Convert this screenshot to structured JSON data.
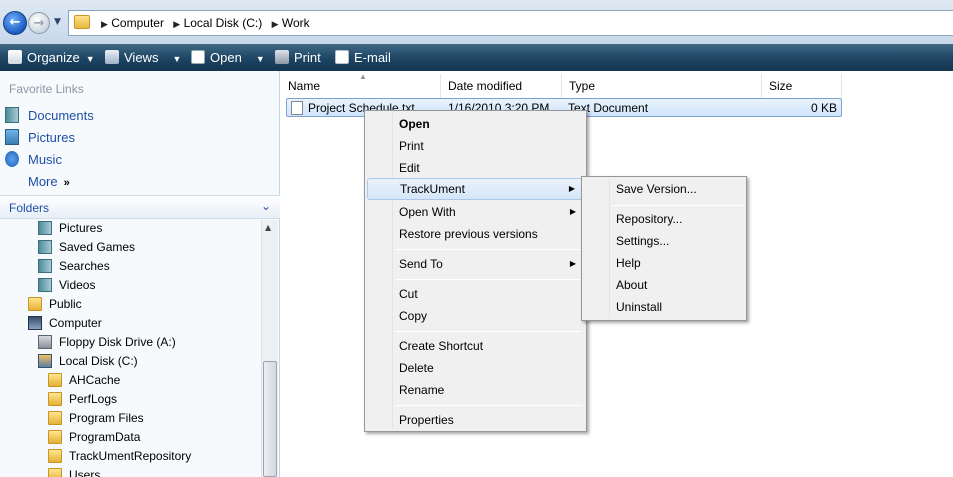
{
  "address": {
    "crumbs": [
      "Computer",
      "Local Disk (C:)",
      "Work"
    ]
  },
  "commandbar": {
    "organize": "Organize",
    "views": "Views",
    "open": "Open",
    "print": "Print",
    "email": "E-mail"
  },
  "leftpane": {
    "favorites_title": "Favorite Links",
    "favorites": [
      "Documents",
      "Pictures",
      "Music"
    ],
    "more": "More",
    "folders_title": "Folders",
    "tree": [
      "Pictures",
      "Saved Games",
      "Searches",
      "Videos",
      "Public",
      "Computer",
      "Floppy Disk Drive (A:)",
      "Local Disk (C:)",
      "AHCache",
      "PerfLogs",
      "Program Files",
      "ProgramData",
      "TrackUmentRepository",
      "Users"
    ]
  },
  "columns": [
    "Name",
    "Date modified",
    "Type",
    "Size"
  ],
  "file": {
    "name": "Project Schedule.txt",
    "date": "1/16/2010 3:20 PM",
    "type": "Text Document",
    "size": "0 KB"
  },
  "context_menu": {
    "open": "Open",
    "print": "Print",
    "edit": "Edit",
    "trackument": "TrackUment",
    "open_with": "Open With",
    "restore": "Restore previous versions",
    "send_to": "Send To",
    "cut": "Cut",
    "copy": "Copy",
    "create_shortcut": "Create Shortcut",
    "delete": "Delete",
    "rename": "Rename",
    "properties": "Properties"
  },
  "submenu": {
    "save_version": "Save Version...",
    "repository": "Repository...",
    "settings": "Settings...",
    "help": "Help",
    "about": "About",
    "uninstall": "Uninstall"
  }
}
